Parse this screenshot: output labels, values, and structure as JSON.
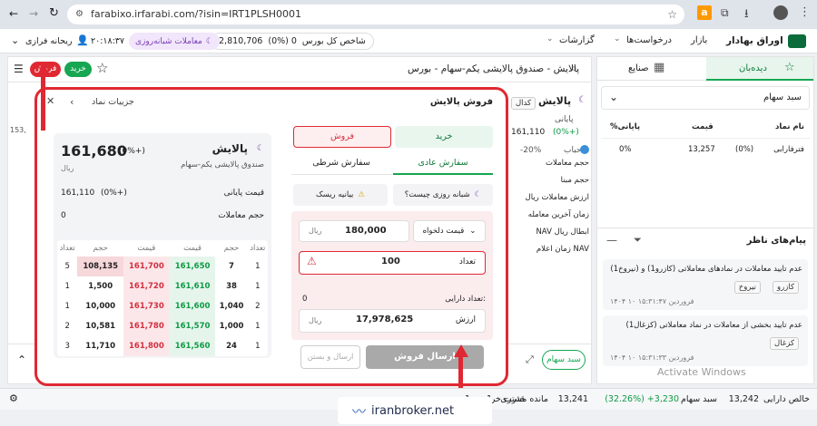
{
  "browser": {
    "url": "farabixo.irfarabi.com/?isin=IRT1PLSH0001"
  },
  "header": {
    "brand": "اوراق بهادار",
    "menu": [
      "بازار",
      "درخواست‌ها",
      "گزارشات"
    ],
    "index_label": "شاخص کل بورس",
    "index_value": "2,810,706",
    "index_change": "(0%) 0",
    "night_trade": "معاملات شبانه‌روزی",
    "time": "۲۰:۱۸:۳۷",
    "user": "ریحانه فرازی"
  },
  "toolbar": {
    "sell_label": "فروش",
    "buy_label": "خرید",
    "symbol_title": "پالایش - صندوق پالایشی یکم-سهام - بورس"
  },
  "tabs": {
    "watchlist": "دیده‌بان",
    "industries": "صنایع"
  },
  "watch": {
    "list_name": "سبد سهام",
    "headers": [
      "نام نماد",
      "قیمت",
      "%پایانی"
    ],
    "rows": [
      {
        "name": "فترفارابی",
        "price": "13,257",
        "change": "(0%)",
        "last": "0%"
      }
    ]
  },
  "messages": {
    "title": "پیام‌های ناظر",
    "items": [
      {
        "text": "عدم تایید معاملات در نمادهای معاملاتی (کازرو1) و (نیروخ1)",
        "tags": [
          "کازرو",
          "نیروخ"
        ],
        "time": "۱۴۰۴ ۱۰ فروردین ۱۵:۳۱:۴۷"
      },
      {
        "text": "عدم تایید بخشی از معاملات در نماد معاملاتی (کزغال1)",
        "tags": [
          "کزغال"
        ],
        "time": "۱۴۰۴ ۱۰ فروردین ۱۵:۳۱:۳۳"
      }
    ],
    "watermark": "Activate Windows"
  },
  "symbol_panel": {
    "name": "پالایش",
    "badge": "کدال",
    "last_label": "پایانی",
    "last": "161,110",
    "last_change": "(0%+)",
    "bubble_label": "حباب",
    "bubble": "-20%",
    "rows": [
      "حجم معاملات",
      "حجم مبنا",
      "ارزش معاملات ریال",
      "زمان آخرین معامله",
      "NAV ابطال ریال",
      "زمان اعلام NAV"
    ],
    "left_cut": "153,"
  },
  "dialog": {
    "title": "فروش پالایش",
    "details_link": "جزییات نماد",
    "buy_tab": "خرید",
    "sell_tab": "فروش",
    "regular_order": "سفارش عادی",
    "conditional_order": "سفارش شرطی",
    "night_question": "شبانه روزی چیست؟",
    "risk_statement": "بیانیه ریسک",
    "price_type": "قیمت دلخواه",
    "price_value": "180,000",
    "price_unit": "ریال",
    "qty_label": "تعداد",
    "qty_value": "100",
    "holding_label": "تعداد دارایی:",
    "holding_value": "0",
    "value_label": "ارزش",
    "value_amount": "17,978,625",
    "value_unit": "ریال",
    "submit": "ارسال فروش",
    "submit_close": "ارسال و بستن"
  },
  "quote": {
    "name": "پالایش",
    "full_name": "صندوق پالایشی یکم-سهام",
    "price": "161,680",
    "change": "(0%+)",
    "unit": "ریال",
    "last_label": "قیمت پایانی",
    "last_value": "161,110",
    "last_change": "(0%+)",
    "volume_label": "حجم معاملات",
    "volume_value": "0"
  },
  "orderbook": {
    "headers": [
      "تعداد",
      "حجم",
      "قیمت",
      "قیمت",
      "حجم",
      "تعداد"
    ],
    "rows": [
      {
        "buy_count": "1",
        "buy_vol": "7",
        "buy_price": "161,650",
        "sell_price": "161,700",
        "sell_vol": "108,135",
        "sell_count": "5"
      },
      {
        "buy_count": "1",
        "buy_vol": "38",
        "buy_price": "161,610",
        "sell_price": "161,720",
        "sell_vol": "1,500",
        "sell_count": "1"
      },
      {
        "buy_count": "2",
        "buy_vol": "1,040",
        "buy_price": "161,600",
        "sell_price": "161,730",
        "sell_vol": "10,000",
        "sell_count": "1"
      },
      {
        "buy_count": "1",
        "buy_vol": "1,000",
        "buy_price": "161,570",
        "sell_price": "161,780",
        "sell_vol": "10,581",
        "sell_count": "2"
      },
      {
        "buy_count": "1",
        "buy_vol": "24",
        "buy_price": "161,560",
        "sell_price": "161,800",
        "sell_vol": "11,710",
        "sell_count": "3"
      }
    ]
  },
  "bottom": {
    "basket_btn": "سبد سهام"
  },
  "status": {
    "net_asset_label": "خالص دارایی",
    "net_asset": "13,242",
    "basket_label": "سبد سهام",
    "basket_change": "(32.26%) +3,230",
    "basket_value": "13,241",
    "remain_label": "مانده مشتری",
    "remain": "1",
    "buy_power_label": "قدرت خرید",
    "buy_power": "1"
  },
  "watermark_site": "iranbroker.net"
}
